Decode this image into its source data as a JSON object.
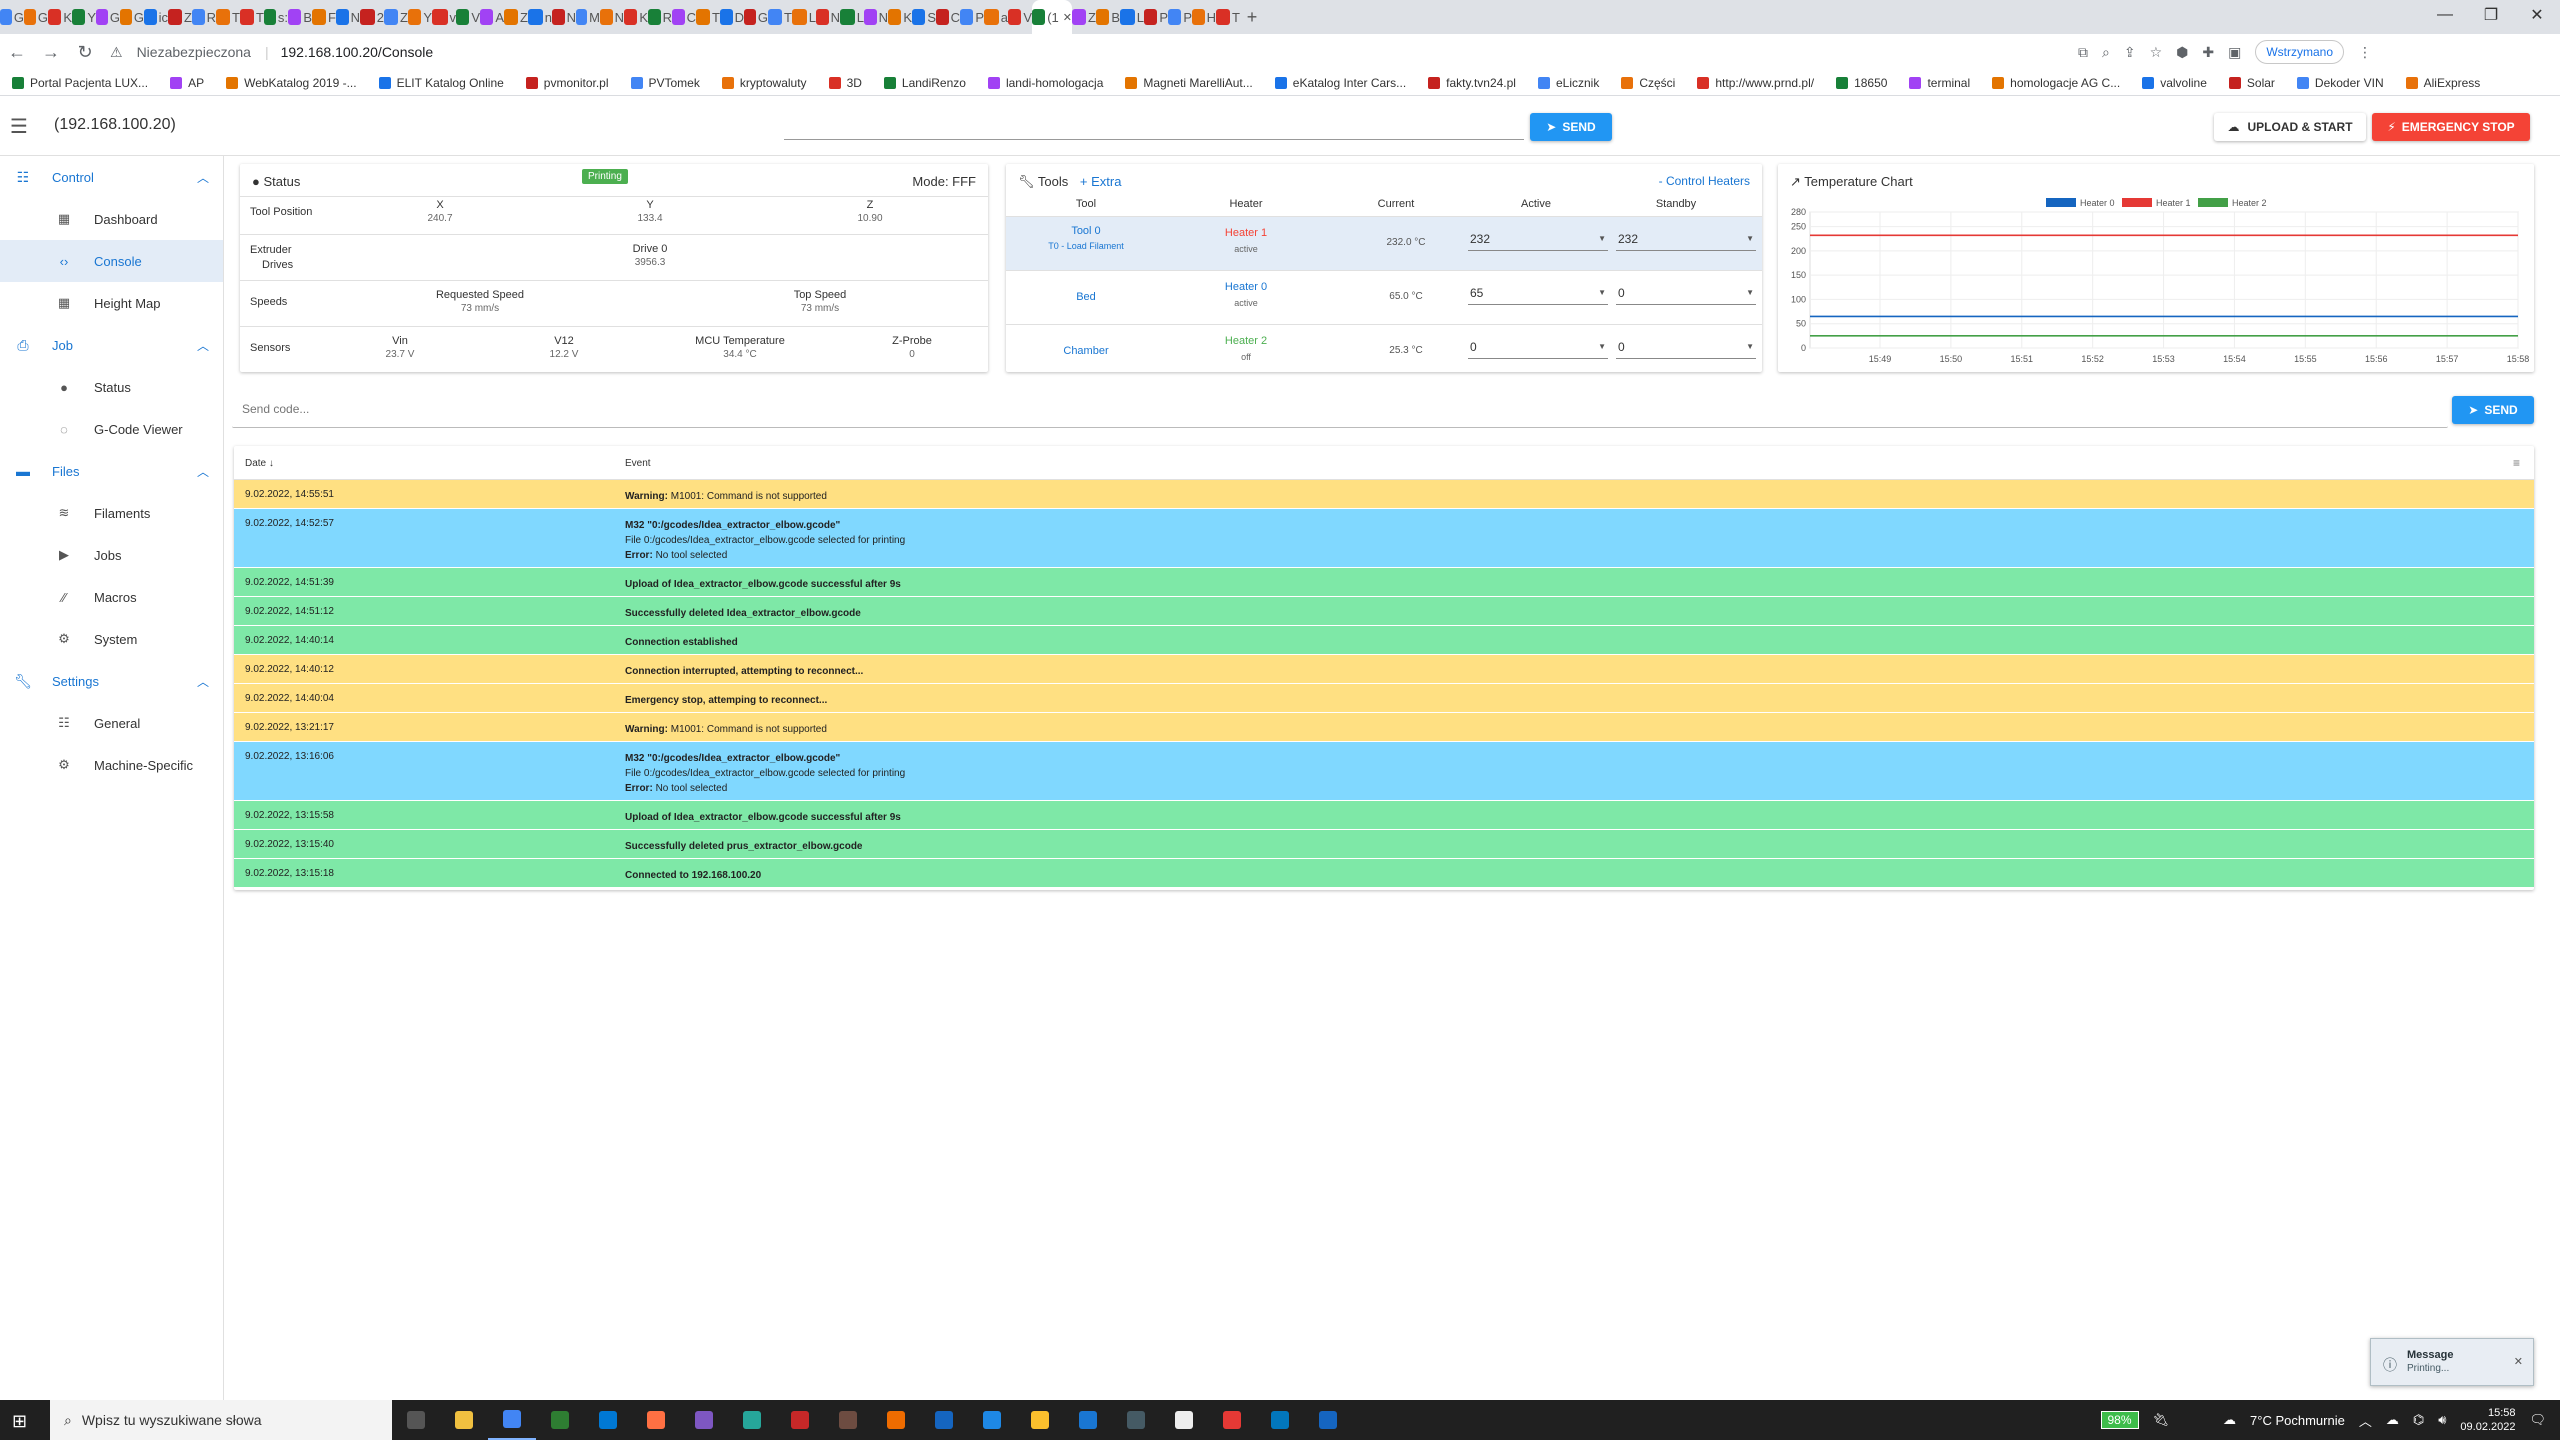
{
  "browser": {
    "tabs": [
      "G",
      "G",
      "K",
      "Y",
      "G",
      "G",
      "ic",
      "Z",
      "R",
      "T",
      "T",
      "s:",
      "B",
      "F",
      "N",
      "2",
      "Z",
      "Y",
      "v",
      "V",
      "A",
      "Z",
      "n",
      "N",
      "M",
      "N",
      "K",
      "R",
      "C",
      "T",
      "D",
      "G",
      "T",
      "L",
      "N",
      "L",
      "N",
      "K",
      "S",
      "C",
      "P",
      "a",
      "V",
      "(1",
      "Z",
      "B",
      "L",
      "P",
      "P",
      "H",
      "T"
    ],
    "active_tab": "(1",
    "insecure_label": "Niezabezpieczona",
    "url": "192.168.100.20/Console",
    "profile_label": "Wstrzymano",
    "bookmarks": [
      "Portal Pacjenta LUX...",
      "AP",
      "WebKatalog 2019 -...",
      "ELIT Katalog Online",
      "pvmonitor.pl",
      "PVTomek",
      "kryptowaluty",
      "3D",
      "LandiRenzo",
      "landi-homologacja",
      "Magneti MarelliAut...",
      "eKatalog Inter Cars...",
      "fakty.tvn24.pl",
      "eLicznik",
      "Części",
      "http://www.prnd.pl/",
      "18650",
      "terminal",
      "homologacje AG C...",
      "valvoline",
      "Solar",
      "Dekoder VIN",
      "AliExpress"
    ]
  },
  "appbar": {
    "title": "(192.168.100.20)",
    "send_label": "SEND",
    "upload_label": "UPLOAD & START",
    "emergency_label": "EMERGENCY STOP"
  },
  "sidebar": {
    "groups": [
      {
        "label": "Control",
        "items": [
          "Dashboard",
          "Console",
          "Height Map"
        ]
      },
      {
        "label": "Job",
        "items": [
          "Status",
          "G-Code Viewer"
        ]
      },
      {
        "label": "Files",
        "items": [
          "Filaments",
          "Jobs",
          "Macros",
          "System"
        ]
      },
      {
        "label": "Settings",
        "items": [
          "General",
          "Machine-Specific"
        ]
      }
    ],
    "active_item": "Console"
  },
  "status": {
    "title": "Status",
    "badge": "Printing",
    "mode": "Mode: FFF",
    "tool_position_label": "Tool Position",
    "x_label": "X",
    "x": "240.7",
    "y_label": "Y",
    "y": "133.4",
    "z_label": "Z",
    "z": "10.90",
    "extruder_label": "Extruder",
    "drives_label": "Drives",
    "drive0_label": "Drive 0",
    "drive0": "3956.3",
    "speeds_label": "Speeds",
    "req_speed_label": "Requested Speed",
    "req_speed": "73 mm/s",
    "top_speed_label": "Top Speed",
    "top_speed": "73 mm/s",
    "sensors_label": "Sensors",
    "vin_label": "Vin",
    "vin": "23.7 V",
    "v12_label": "V12",
    "v12": "12.2 V",
    "mcu_label": "MCU Temperature",
    "mcu": "34.4 °C",
    "zprobe_label": "Z-Probe",
    "zprobe": "0"
  },
  "tools": {
    "title": "Tools",
    "extra": "Extra",
    "control_heaters": "Control Heaters",
    "headers": [
      "Tool",
      "Heater",
      "Current",
      "Active",
      "Standby"
    ],
    "rows": [
      {
        "name": "Tool 0",
        "sub": "T0 - Load Filament",
        "heater": "Heater 1",
        "heater_color": "#f44336",
        "state": "active",
        "current": "232.0 °C",
        "active": "232",
        "standby": "232"
      },
      {
        "name": "Bed",
        "sub": "",
        "heater": "Heater 0",
        "heater_color": "#1976d2",
        "state": "active",
        "current": "65.0 °C",
        "active": "65",
        "standby": "0"
      },
      {
        "name": "Chamber",
        "sub": "",
        "heater": "Heater 2",
        "heater_color": "#4caf50",
        "state": "off",
        "current": "25.3 °C",
        "active": "0",
        "standby": "0"
      }
    ]
  },
  "chart_data": {
    "type": "line",
    "title": "Temperature Chart",
    "x": [
      "15:49",
      "15:50",
      "15:51",
      "15:52",
      "15:53",
      "15:54",
      "15:55",
      "15:56",
      "15:57",
      "15:58"
    ],
    "ylim": [
      0,
      280
    ],
    "yticks": [
      0,
      50,
      100,
      150,
      200,
      250,
      280
    ],
    "legend_position": "top",
    "series": [
      {
        "name": "Heater 0",
        "color": "#1565c0",
        "values": [
          65,
          65,
          65,
          65,
          65,
          65,
          65,
          65,
          65,
          65
        ]
      },
      {
        "name": "Heater 1",
        "color": "#e53935",
        "values": [
          232,
          232,
          232,
          232,
          232,
          232,
          232,
          232,
          232,
          232
        ]
      },
      {
        "name": "Heater 2",
        "color": "#43a047",
        "values": [
          25,
          25,
          25,
          25,
          25,
          25,
          25,
          25,
          25,
          25
        ]
      }
    ]
  },
  "code": {
    "placeholder": "Send code...",
    "send_label": "SEND"
  },
  "console": {
    "date_header": "Date",
    "event_header": "Event",
    "events": [
      {
        "type": "warn",
        "date": "9.02.2022, 14:55:51",
        "lines": [
          {
            "b": "Warning: ",
            "t": "M1001: Command is not supported"
          }
        ]
      },
      {
        "type": "info",
        "date": "9.02.2022, 14:52:57",
        "lines": [
          {
            "b": "M32 \"0:/gcodes/Idea_extractor_elbow.gcode\"",
            "t": ""
          },
          {
            "b": "",
            "t": "File 0:/gcodes/Idea_extractor_elbow.gcode selected for printing"
          },
          {
            "b": "Error: ",
            "t": "No tool selected"
          }
        ]
      },
      {
        "type": "ok",
        "date": "9.02.2022, 14:51:39",
        "lines": [
          {
            "b": "Upload of Idea_extractor_elbow.gcode successful after 9s",
            "t": ""
          }
        ]
      },
      {
        "type": "ok",
        "date": "9.02.2022, 14:51:12",
        "lines": [
          {
            "b": "Successfully deleted Idea_extractor_elbow.gcode",
            "t": ""
          }
        ]
      },
      {
        "type": "ok",
        "date": "9.02.2022, 14:40:14",
        "lines": [
          {
            "b": "Connection established",
            "t": ""
          }
        ]
      },
      {
        "type": "warn",
        "date": "9.02.2022, 14:40:12",
        "lines": [
          {
            "b": "Connection interrupted, attempting to reconnect...",
            "t": ""
          }
        ]
      },
      {
        "type": "warn",
        "date": "9.02.2022, 14:40:04",
        "lines": [
          {
            "b": "Emergency stop, attemping to reconnect...",
            "t": ""
          }
        ]
      },
      {
        "type": "warn",
        "date": "9.02.2022, 13:21:17",
        "lines": [
          {
            "b": "Warning: ",
            "t": "M1001: Command is not supported"
          }
        ]
      },
      {
        "type": "info",
        "date": "9.02.2022, 13:16:06",
        "lines": [
          {
            "b": "M32 \"0:/gcodes/Idea_extractor_elbow.gcode\"",
            "t": ""
          },
          {
            "b": "",
            "t": "File 0:/gcodes/Idea_extractor_elbow.gcode selected for printing"
          },
          {
            "b": "Error: ",
            "t": "No tool selected"
          }
        ]
      },
      {
        "type": "ok",
        "date": "9.02.2022, 13:15:58",
        "lines": [
          {
            "b": "Upload of Idea_extractor_elbow.gcode successful after 9s",
            "t": ""
          }
        ]
      },
      {
        "type": "ok",
        "date": "9.02.2022, 13:15:40",
        "lines": [
          {
            "b": "Successfully deleted prus_extractor_elbow.gcode",
            "t": ""
          }
        ]
      },
      {
        "type": "ok",
        "date": "9.02.2022, 13:15:18",
        "lines": [
          {
            "b": "Connected to 192.168.100.20",
            "t": ""
          }
        ]
      }
    ]
  },
  "toast": {
    "title": "Message",
    "text": "Printing..."
  },
  "taskbar": {
    "search_placeholder": "Wpisz tu wyszukiwane słowa",
    "battery": "98%",
    "weather": "7°C  Pochmurnie",
    "time": "15:58",
    "date": "09.02.2022"
  }
}
